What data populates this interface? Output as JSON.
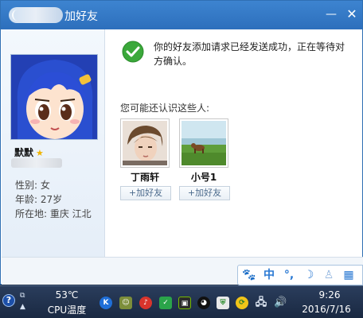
{
  "window": {
    "title": "加好友",
    "minimize_glyph": "—",
    "close_glyph": "✕"
  },
  "profile": {
    "nickname": "默默",
    "gender": "性别: 女",
    "age": "年龄: 27岁",
    "location": "所在地: 重庆  江北"
  },
  "main": {
    "success_message": "你的好友添加请求已经发送成功，正在等待对方确认。",
    "suggest_heading": "您可能还认识这些人:",
    "suggestions": [
      {
        "name": "丁雨轩",
        "add_label": "+加好友"
      },
      {
        "name": "小号1",
        "add_label": "+加好友"
      }
    ]
  },
  "ime": {
    "items": [
      "paw-icon",
      "中",
      "°,",
      "moon-icon",
      "user-icon",
      "grid-icon"
    ],
    "chinese_label": "中",
    "punct_label": "°,"
  },
  "taskbar": {
    "cpu_temp": "53℃",
    "cpu_label": "CPU温度",
    "time": "9:26",
    "date": "2016/7/16"
  },
  "colors": {
    "title_bar": "#2d6fbc",
    "taskbar": "#1a2942",
    "success_green": "#3aa83a"
  }
}
